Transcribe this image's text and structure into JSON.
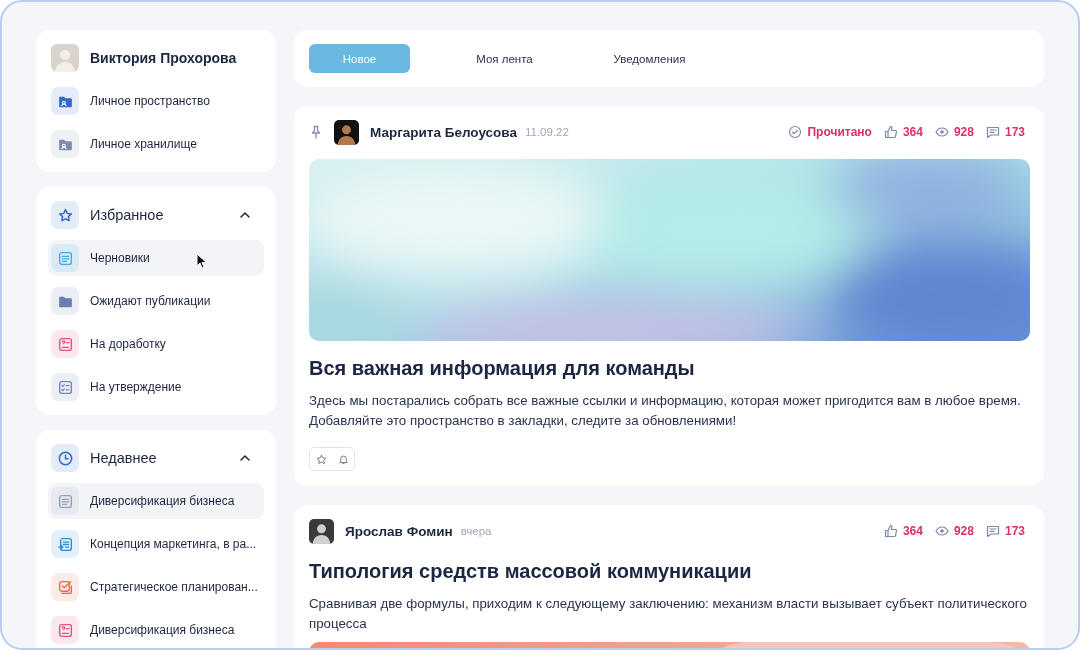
{
  "profile": {
    "name": "Виктория Прохорова",
    "links": [
      {
        "label": "Личное пространство",
        "kind": "folder-user",
        "color": "#3567d0"
      },
      {
        "label": "Личное хранилище",
        "kind": "folder-user",
        "color": "#7d8bb0"
      }
    ]
  },
  "sections": [
    {
      "title": "Избранное",
      "kind": "star",
      "color": "#3567d0",
      "expanded": true,
      "items": [
        {
          "label": "Черновики",
          "kind": "doc",
          "color": "#3fb0df",
          "selected": true
        },
        {
          "label": "Ожидают публикации",
          "kind": "folder",
          "color": "#6a7eb4",
          "selected": false
        },
        {
          "label": "На доработку",
          "kind": "question-doc",
          "color": "#e2508a",
          "selected": false
        },
        {
          "label": "На утверждение",
          "kind": "checklist",
          "color": "#7486b6",
          "selected": false
        }
      ]
    },
    {
      "title": "Недавнее",
      "kind": "clock",
      "color": "#3567d0",
      "expanded": true,
      "items": [
        {
          "label": "Диверсификация бизнеса",
          "kind": "doc",
          "color": "#98a2b6",
          "selected": true
        },
        {
          "label": "Концепция маркетинга, в ра...",
          "kind": "list-arrow",
          "color": "#2b8fd8",
          "selected": false
        },
        {
          "label": "Стратегическое планирован...",
          "kind": "check-square",
          "color": "#ec6849",
          "selected": false
        },
        {
          "label": "Диверсификация бизнеса",
          "kind": "question-doc",
          "color": "#e2508a",
          "selected": false
        }
      ]
    }
  ],
  "tabs": [
    {
      "label": "Новое",
      "selected": true
    },
    {
      "label": "Моя лента",
      "selected": false
    },
    {
      "label": "Уведомления",
      "selected": false
    }
  ],
  "posts": [
    {
      "pinned": true,
      "author": "Маргарита Белоусова",
      "date": "11.09.22",
      "status": "Прочитано",
      "likes": "364",
      "views": "928",
      "comments": "173",
      "title": "Вся важная информация для команды",
      "text": "Здесь мы постарались собрать все важные ссылки и информацию, которая может пригодится вам в любое время. Добавляйте это пространство в закладки, следите за обновлениями!",
      "actions": true
    },
    {
      "pinned": false,
      "author": "Ярослав Фомин",
      "date": "вчера",
      "likes": "364",
      "views": "928",
      "comments": "173",
      "title": "Типология средств массовой коммуникации",
      "text": "Сравнивая две формулы, приходим к следующему заключению: механизм власти вызывает субъект политического процесса",
      "actions": false
    }
  ]
}
